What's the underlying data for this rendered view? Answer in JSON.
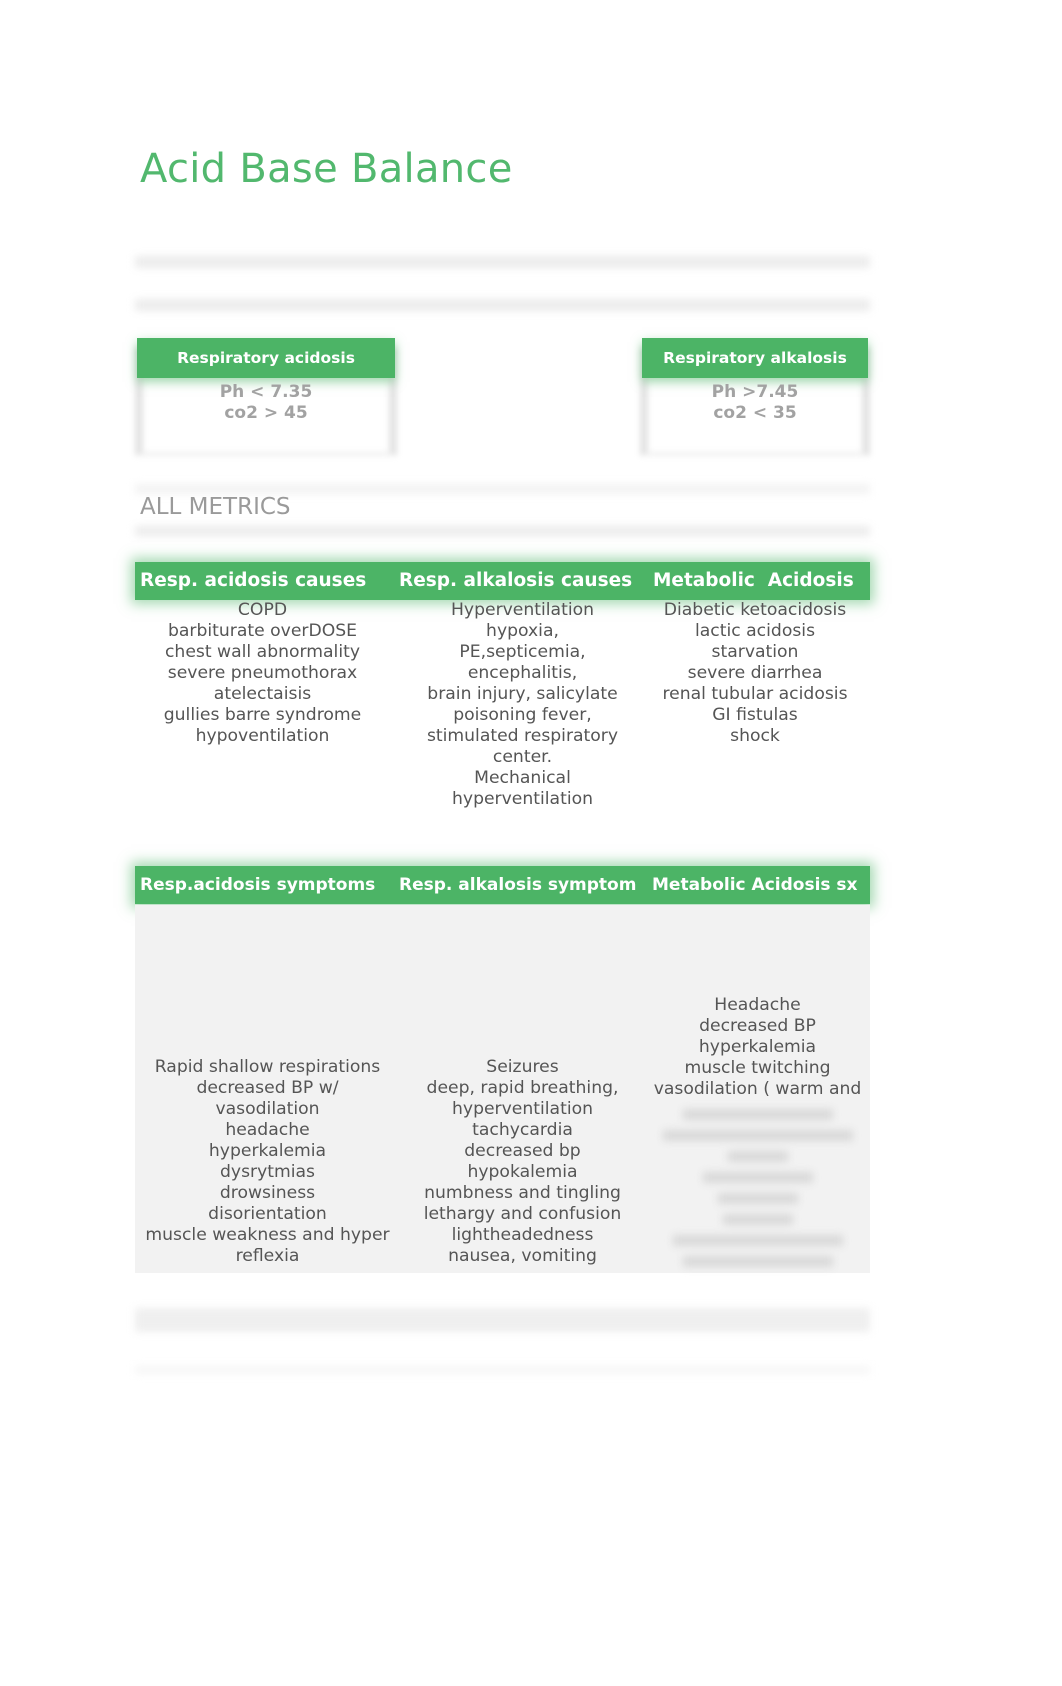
{
  "document": {
    "title": "Acid Base Balance",
    "section_label": "ALL METRICS",
    "theme": {
      "accent": "#4cb466",
      "title_color": "#52b86e"
    }
  },
  "cards": [
    {
      "header": "Respiratory acidosis",
      "lines": [
        "Ph < 7.35",
        "co2 > 45"
      ]
    },
    {
      "header": "Respiratory alkalosis",
      "lines": [
        "Ph >7.45",
        "co2 < 35"
      ]
    }
  ],
  "causes": {
    "headers": [
      "Resp. acidosis causes",
      "Resp. alkalosis causes",
      "Metabolic  Acidosis"
    ],
    "columns": [
      [
        "COPD",
        "barbiturate overDOSE",
        "chest wall abnormality",
        "severe pneumothorax",
        "atelectaisis",
        "gullies barre syndrome",
        "hypoventilation"
      ],
      [
        "Hyperventilation",
        "hypoxia,",
        "PE,septicemia,",
        "encephalitis,",
        "brain injury, salicylate",
        "poisoning fever,",
        "stimulated respiratory",
        "center.",
        "Mechanical",
        "hyperventilation"
      ],
      [
        "Diabetic ketoacidosis",
        "lactic acidosis",
        "starvation",
        "severe diarrhea",
        "renal tubular acidosis",
        "GI fistulas",
        "shock"
      ]
    ]
  },
  "symptoms": {
    "headers": [
      "Resp.acidosis symptoms",
      "Resp. alkalosis symptom",
      "Metabolic Acidosis sx"
    ],
    "columns": [
      [
        "Rapid shallow respirations",
        "decreased BP w/",
        "vasodilation",
        "headache",
        "hyperkalemia",
        "dysrytmias",
        "drowsiness",
        "disorientation",
        "muscle weakness and hyper",
        "reflexia"
      ],
      [
        "Seizures",
        "deep, rapid breathing,",
        "hyperventilation",
        "tachycardia",
        "decreased bp",
        "hypokalemia",
        "numbness and tingling",
        "lethargy and confusion",
        "lightheadedness",
        "nausea, vomiting"
      ],
      [
        "Headache",
        "decreased BP",
        "hyperkalemia",
        "muscle twitching",
        "vasodilation ( warm and"
      ]
    ],
    "obscured_lines_in_col3": 8
  }
}
